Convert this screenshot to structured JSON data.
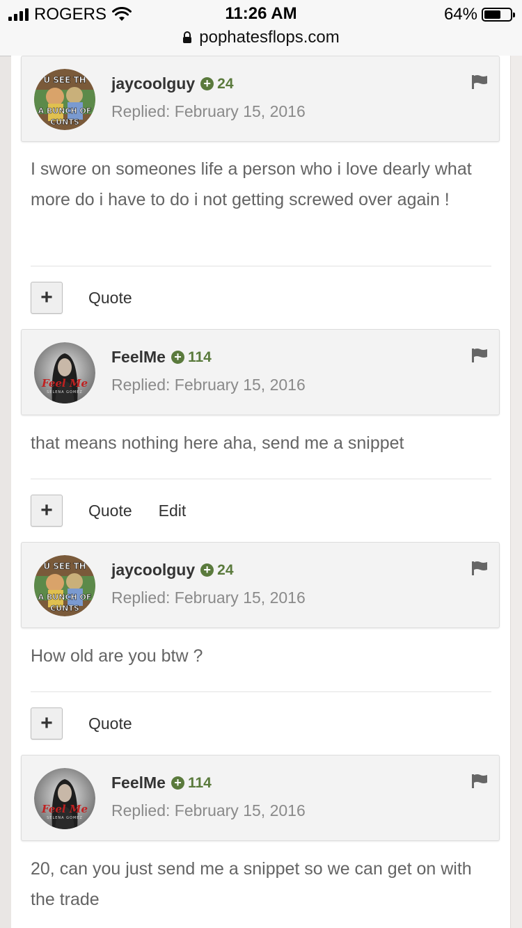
{
  "status_bar": {
    "carrier": "ROGERS",
    "time": "11:26 AM",
    "battery_percent": "64%",
    "battery_level": 0.64,
    "url": "pophatesflops.com"
  },
  "avatars": {
    "jaycoolguy": {
      "top_text": "U SEE TH",
      "bottom_line1": "A BUNCH OF",
      "bottom_line2": "CUNTS"
    },
    "feelme": {
      "text": "Feel Me",
      "subtext": "SELENA GOMEZ"
    }
  },
  "posts": [
    {
      "author": "jaycoolguy",
      "rep": "24",
      "date": "Replied: February 15, 2016",
      "body": "I swore on someones life a person who i love dearly what more do i have to do i not getting screwed over again !",
      "actions": [
        "Quote"
      ]
    },
    {
      "author": "FeelMe",
      "rep": "114",
      "date": "Replied: February 15, 2016",
      "body": "that means nothing here aha, send me a snippet",
      "actions": [
        "Quote",
        "Edit"
      ]
    },
    {
      "author": "jaycoolguy",
      "rep": "24",
      "date": "Replied: February 15, 2016",
      "body": "How old are you btw ?",
      "actions": [
        "Quote"
      ]
    },
    {
      "author": "FeelMe",
      "rep": "114",
      "date": "Replied: February 15, 2016",
      "body": "20, can you just send me a snippet so we can get on with the trade",
      "actions": []
    }
  ],
  "icons": {
    "rep": "plus-circle-icon",
    "flag": "flag-icon",
    "add": "plus-icon",
    "lock": "lock-icon"
  },
  "colors": {
    "rep_green": "#5a7a3c",
    "body_text": "#646464",
    "date_text": "#8a8a8a",
    "header_bg": "#f3f3f3"
  }
}
